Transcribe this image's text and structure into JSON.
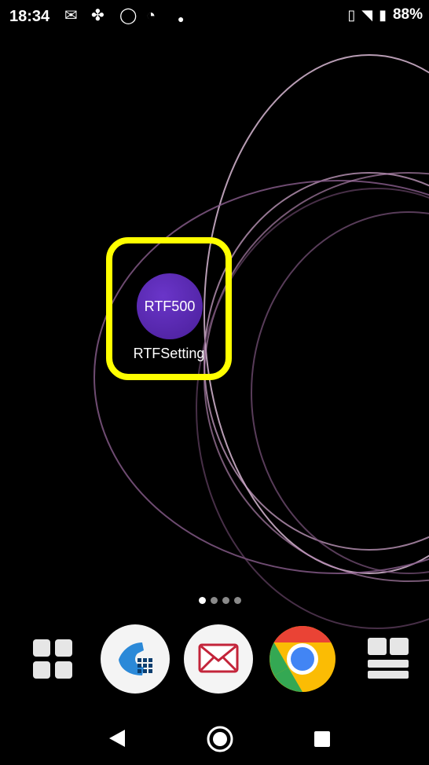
{
  "status_bar": {
    "time": "18:34",
    "battery": "88%",
    "icons": [
      "mail-icon",
      "pinwheel-icon",
      "chat-bubble-icon",
      "messenger-icon",
      "dot-icon",
      "vibrate-icon",
      "wifi-icon",
      "battery-icon"
    ]
  },
  "home": {
    "app": {
      "icon_text": "RTF500",
      "label": "RTFSetting"
    },
    "page_indicator": {
      "pages": 4,
      "current": 1
    }
  },
  "dock": {
    "items": [
      {
        "name": "app-drawer",
        "icon": "grid-icon"
      },
      {
        "name": "phone",
        "icon": "phone-icon"
      },
      {
        "name": "email",
        "icon": "envelope-icon"
      },
      {
        "name": "chrome",
        "icon": "chrome-icon"
      },
      {
        "name": "widgets",
        "icon": "widget-list-icon"
      }
    ]
  },
  "nav": {
    "icons": [
      "back-icon",
      "home-icon",
      "recents-icon"
    ]
  },
  "colors": {
    "highlight": "#ffff00",
    "app_icon": "#5b2bb8",
    "wallpaper_rings": "#c9a7c7"
  }
}
